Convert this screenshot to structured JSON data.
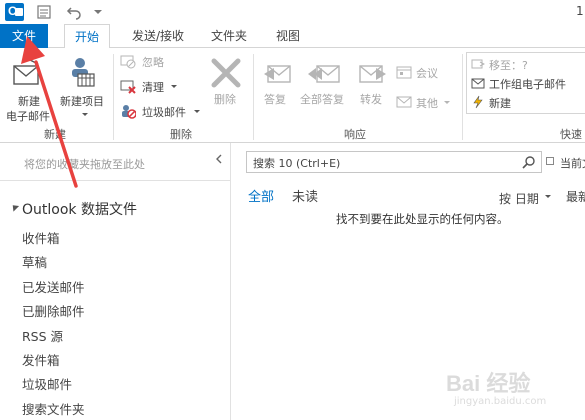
{
  "titlebar": {
    "page_indicator": "1"
  },
  "tabs": [
    {
      "label": "文件"
    },
    {
      "label": "开始"
    },
    {
      "label": "发送/接收"
    },
    {
      "label": "文件夹"
    },
    {
      "label": "视图"
    }
  ],
  "ribbon": {
    "new_email": {
      "line1": "新建",
      "line2": "电子邮件"
    },
    "new_items": {
      "label": "新建项目"
    },
    "group_new": "新建",
    "ignore": "忽略",
    "cleanup": "清理",
    "junk": "垃圾邮件",
    "delete": "删除",
    "group_delete": "删除",
    "reply": "答复",
    "reply_all": "全部答复",
    "forward": "转发",
    "meeting": "会议",
    "more": "其他",
    "group_respond": "响应",
    "move_to": "移至：?",
    "team_email": "工作组电子邮件",
    "create_new": "新建",
    "group_quick": "快速"
  },
  "nav": {
    "favorites_hint": "将您的收藏夹拖放至此处",
    "root": "Outlook 数据文件",
    "folders": [
      "收件箱",
      "草稿",
      "已发送邮件",
      "已删除邮件",
      "RSS 源",
      "发件箱",
      "垃圾邮件",
      "搜索文件夹"
    ]
  },
  "main": {
    "search_placeholder": "搜索 10 (Ctrl+E)",
    "scope": "当前文",
    "filter_all": "全部",
    "filter_unread": "未读",
    "sort_by": "按 日期",
    "sort_order": "最新",
    "empty_message": "找不到要在此处显示的任何内容。"
  },
  "watermark": {
    "text": "Bai 经验",
    "sub": "jingyan.baidu.com"
  },
  "colors": {
    "accent": "#0072c6",
    "annotation_arrow": "#e8423f"
  }
}
